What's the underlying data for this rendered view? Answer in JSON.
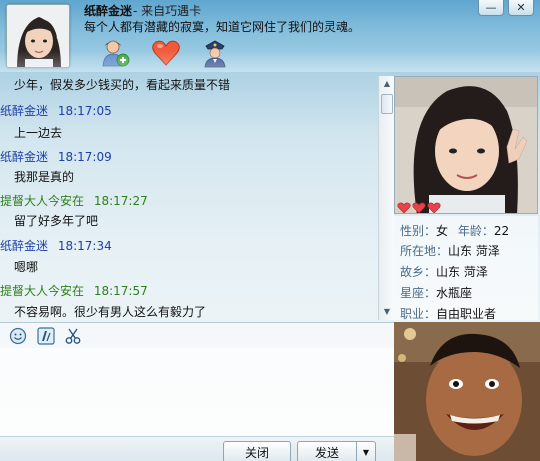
{
  "header": {
    "contact_name": "纸醉金迷",
    "contact_source": "- 来自巧遇卡",
    "signature": "每个人都有潜藏的寂寞，知道它网住了我们的灵魂。",
    "icons": [
      "add-friend-icon",
      "heart-icon",
      "police-icon"
    ],
    "window_buttons": [
      "—",
      "✕"
    ]
  },
  "messages": [
    {
      "text": "少年，假发多少钱买的，看起来质量不错"
    },
    {
      "sender": "纸醉金迷",
      "time": "18:17:05",
      "color": "#1c3fa8",
      "text": "上一边去"
    },
    {
      "sender": "纸醉金迷",
      "time": "18:17:09",
      "color": "#1c3fa8",
      "text": "我那是真的"
    },
    {
      "sender": "提督大人今安在",
      "time": "18:17:27",
      "color": "#2f7f1e",
      "text": "留了好多年了吧"
    },
    {
      "sender": "纸醉金迷",
      "time": "18:17:34",
      "color": "#1c3fa8",
      "text": "嗯哪"
    },
    {
      "sender": "提督大人今安在",
      "time": "18:17:57",
      "color": "#2f7f1e",
      "text": "不容易啊。很少有男人这么有毅力了"
    }
  ],
  "toolbar": {
    "icons": [
      "smiley-icon",
      "font-icon",
      "scissors-icon"
    ]
  },
  "buttons": {
    "close": "关闭",
    "send": "发送",
    "send_options": "▼"
  },
  "profile": {
    "hearts": 3,
    "gender_label": "性别：",
    "gender": "女",
    "age_label": "年龄：",
    "age": "22",
    "location_label": "所在地：",
    "location": "山东 菏泽",
    "hometown_label": "故乡：",
    "hometown": "山东 菏泽",
    "zodiac_label": "星座：",
    "zodiac": "水瓶座",
    "job_label": "职业：",
    "job": "自由职业者"
  }
}
